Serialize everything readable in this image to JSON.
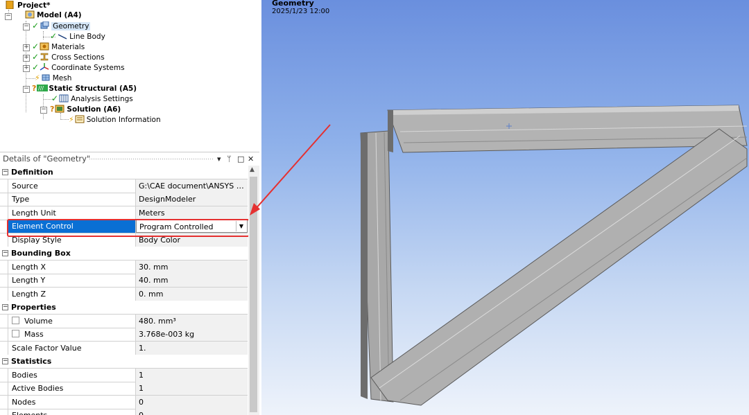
{
  "tree": {
    "project": "Project*",
    "model": "Model (A4)",
    "geometry": "Geometry",
    "line_body": "Line Body",
    "materials": "Materials",
    "cross_sections": "Cross Sections",
    "coordinate_systems": "Coordinate Systems",
    "mesh": "Mesh",
    "static_structural": "Static Structural (A5)",
    "analysis_settings": "Analysis Settings",
    "solution": "Solution (A6)",
    "solution_information": "Solution Information"
  },
  "details": {
    "title": "Details of \"Geometry\"",
    "definition": {
      "header": "Definition",
      "rows": [
        {
          "label": "Source",
          "value": "G:\\CAE document\\ANSYS stati..."
        },
        {
          "label": "Type",
          "value": "DesignModeler"
        },
        {
          "label": "Length Unit",
          "value": "Meters"
        },
        {
          "label": "Element Control",
          "value": "Program Controlled"
        },
        {
          "label": "Display Style",
          "value": "Body Color"
        }
      ]
    },
    "bounding_box": {
      "header": "Bounding Box",
      "rows": [
        {
          "label": "Length X",
          "value": "30. mm"
        },
        {
          "label": "Length Y",
          "value": "40. mm"
        },
        {
          "label": "Length Z",
          "value": "0. mm"
        }
      ]
    },
    "properties": {
      "header": "Properties",
      "rows": [
        {
          "label": "Volume",
          "value": "480. mm³"
        },
        {
          "label": "Mass",
          "value": "3.768e-003 kg"
        },
        {
          "label": "Scale Factor Value",
          "value": "1."
        }
      ]
    },
    "statistics": {
      "header": "Statistics",
      "rows": [
        {
          "label": "Bodies",
          "value": "1"
        },
        {
          "label": "Active Bodies",
          "value": "1"
        },
        {
          "label": "Nodes",
          "value": "0"
        },
        {
          "label": "Elements",
          "value": "0"
        }
      ]
    }
  },
  "viewport": {
    "title": "Geometry",
    "date": "2025/1/23 12:00"
  },
  "colors": {
    "selection": "#0a6fd4",
    "highlight_box": "#e53030",
    "check": "#1a9c1a",
    "beam": "#a9a9a9"
  },
  "icons": [
    "project-icon",
    "model-icon",
    "geometry-icon",
    "line-body-icon",
    "materials-icon",
    "cross-sections-icon",
    "coordinate-systems-icon",
    "mesh-icon",
    "static-structural-icon",
    "analysis-settings-icon",
    "solution-icon",
    "solution-information-icon",
    "pin-icon",
    "maximize-icon",
    "close-icon",
    "dropdown-arrow-icon"
  ]
}
